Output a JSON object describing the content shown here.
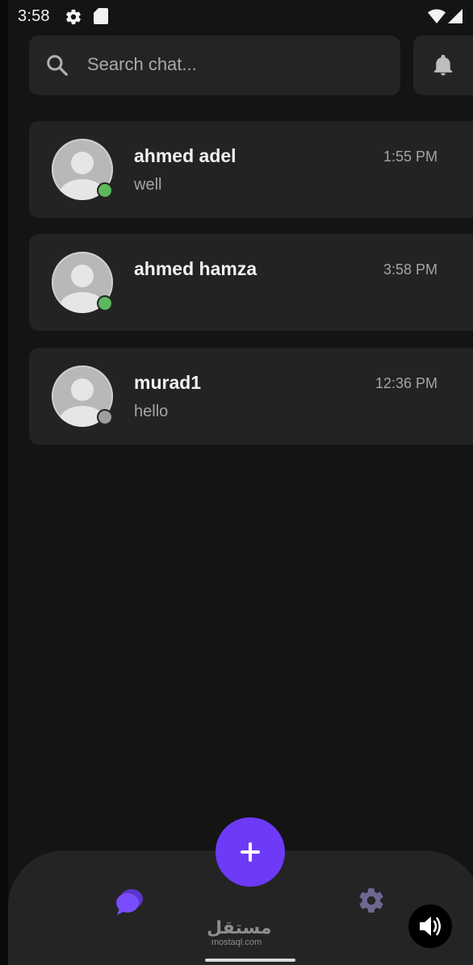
{
  "status_bar": {
    "time": "3:58",
    "icons": [
      "gear-icon",
      "sd-card-icon",
      "wifi-icon",
      "signal-icon"
    ]
  },
  "search": {
    "placeholder": "Search chat...",
    "value": "",
    "icon": "search-icon"
  },
  "header": {
    "notification_icon": "bell-icon"
  },
  "chats": [
    {
      "name": "ahmed adel",
      "time": "1:55 PM",
      "preview": "well",
      "online": true
    },
    {
      "name": "ahmed hamza",
      "time": "3:58 PM",
      "preview": "",
      "online": true
    },
    {
      "name": "murad1",
      "time": "12:36 PM",
      "preview": "hello",
      "online": false
    }
  ],
  "bottom_nav": {
    "items": [
      "chat-bubbles-icon",
      "gear-icon"
    ],
    "active": "chat-bubbles-icon",
    "fab_icon": "plus-icon"
  },
  "watermark": {
    "arabic": "مستقل",
    "latin": "mostaql.com"
  },
  "overlay": {
    "volume_icon": "volume-icon"
  },
  "colors": {
    "background": "#141414",
    "card": "#232323",
    "accent": "#6d3bf7",
    "online": "#5cb85c",
    "offline": "#9e9e9e",
    "text_primary": "#f1f1f1",
    "text_secondary": "#a5a5a5"
  }
}
